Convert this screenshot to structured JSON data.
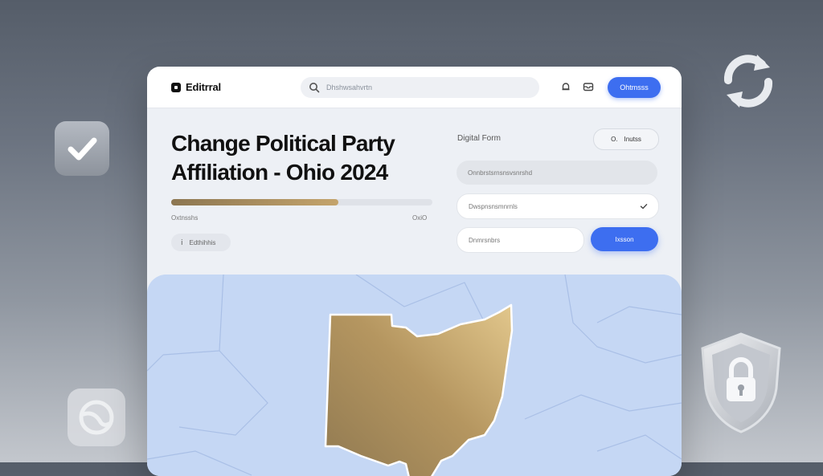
{
  "brand": {
    "name": "Editrral",
    "icon": "logo-icon"
  },
  "search": {
    "placeholder": "Dhshwsahvrtn",
    "icon": "search-icon"
  },
  "topbar": {
    "icons": [
      "bell-icon",
      "inbox-icon"
    ],
    "primary_button": "Ohtmsss"
  },
  "page": {
    "title_line1": "Change Political Party",
    "title_line2": "Affiliation - Ohio 2024",
    "progress": {
      "value": 0.64,
      "left_label": "Oxtnsshs",
      "right_label": "OxiO",
      "color_start": "#8c7651",
      "color_end": "#c4a46c"
    },
    "chip": {
      "icon": "info-icon",
      "label": "Edthihhis"
    }
  },
  "form": {
    "label": "Digital Form",
    "badge": {
      "icon_text": "O.",
      "text": "Inutss"
    },
    "fields": [
      {
        "value": "Onnbrstsrnsnsvsnrshd"
      },
      {
        "value": "Dwspnsnsmnrnls"
      },
      {
        "value": "Dnmrsnbrs"
      }
    ],
    "submit": "Ixsson"
  },
  "map": {
    "highlight_region": "Ohio",
    "highlight_color": "#c7a56c",
    "base_color": "#c5d7f4"
  },
  "decor": {
    "icons": [
      "checkmark-icon",
      "refresh-icon",
      "shield-lock-icon",
      "globe-icon"
    ]
  },
  "colors": {
    "accent": "#3d6ef0",
    "gold": "#b59660"
  }
}
